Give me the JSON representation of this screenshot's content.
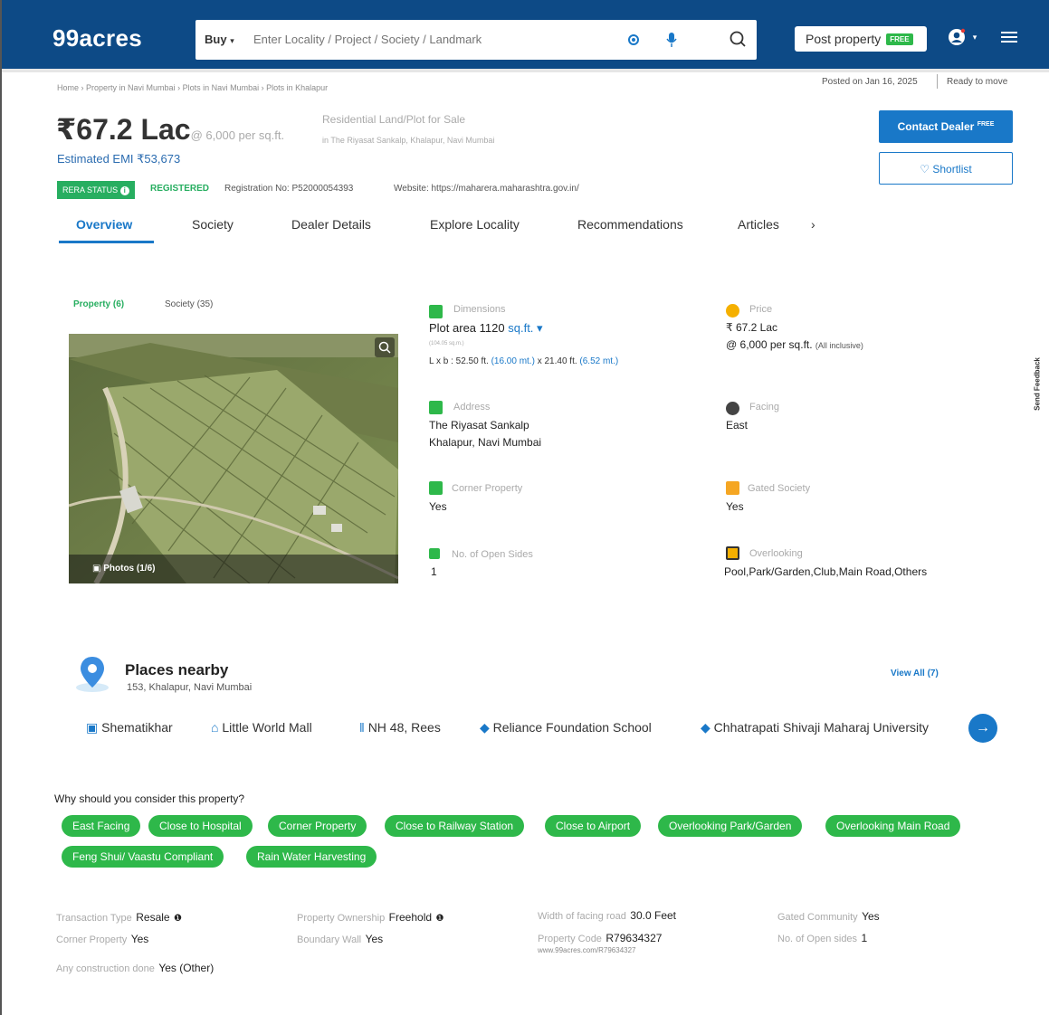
{
  "header": {
    "logo": "99acres",
    "search_mode": "Buy",
    "search_placeholder": "Enter Locality / Project / Society / Landmark",
    "post_label": "Post property",
    "post_badge": "FREE"
  },
  "breadcrumb": {
    "items": [
      "Home",
      "Property in Navi Mumbai",
      "Plots in Navi Mumbai",
      "Plots in Khalapur"
    ],
    "posted": "Posted on Jan 16, 2025",
    "ready": "Ready to move"
  },
  "summary": {
    "price": "₹67.2 Lac",
    "per_sqft": "@ 6,000 per sq.ft.",
    "emi": "Estimated EMI ₹53,673",
    "type": "Residential Land/Plot for Sale",
    "location": "in The Riyasat Sankalp, Khalapur, Navi Mumbai",
    "rera_status": "RERA STATUS",
    "registered": "REGISTERED",
    "registration": "Registration No: P52000054393",
    "website": "Website: https://maharera.maharashtra.gov.in/",
    "contact_label": "Contact Dealer",
    "contact_badge": "FREE",
    "shortlist_label": "Shortlist"
  },
  "tabs": [
    "Overview",
    "Society",
    "Dealer Details",
    "Explore Locality",
    "Recommendations",
    "Articles"
  ],
  "media": {
    "property_tab": "Property (6)",
    "society_tab": "Society (35)",
    "photos_label": "Photos (1/6)"
  },
  "details": {
    "dimensions": {
      "label": "Dimensions",
      "plot_area": "Plot area 1120",
      "unit": "sq.ft.",
      "sqm": "(104.05 sq.m.)",
      "lxb": "L x b : 52.50 ft.",
      "lxb_m1": "(16.00 mt.)",
      "x": "x 21.40 ft.",
      "lxb_m2": "(6.52 mt.)"
    },
    "price": {
      "label": "Price",
      "value": "₹ 67.2 Lac",
      "per": "@ 6,000 per sq.ft.",
      "incl": "(All inclusive)"
    },
    "address": {
      "label": "Address",
      "line1": "The Riyasat Sankalp",
      "line2": "Khalapur, Navi Mumbai"
    },
    "facing": {
      "label": "Facing",
      "value": "East"
    },
    "corner": {
      "label": "Corner Property",
      "value": "Yes"
    },
    "gated": {
      "label": "Gated Society",
      "value": "Yes"
    },
    "open_sides": {
      "label": "No. of Open Sides",
      "value": "1"
    },
    "overlooking": {
      "label": "Overlooking",
      "value": "Pool,Park/Garden,Club,Main Road,Others"
    }
  },
  "places": {
    "title": "Places nearby",
    "subtitle": "153, Khalapur, Navi Mumbai",
    "view_all": "View All (7)",
    "items": [
      "Shematikhar",
      "Little World Mall",
      "NH 48, Rees",
      "Reliance Foundation School",
      "Chhatrapati Shivaji Maharaj University"
    ]
  },
  "why": {
    "title": "Why should you consider this property?",
    "chips_row1": [
      "East Facing",
      "Close to Hospital",
      "Corner Property",
      "Close to Railway Station",
      "Close to Airport",
      "Overlooking Park/Garden",
      "Overlooking Main Road"
    ],
    "chips_row2": [
      "Feng Shui/ Vaastu Compliant",
      "Rain Water Harvesting"
    ]
  },
  "more": {
    "transaction": {
      "label": "Transaction Type",
      "value": "Resale"
    },
    "ownership": {
      "label": "Property Ownership",
      "value": "Freehold"
    },
    "width": {
      "label": "Width of facing road",
      "value": "30.0 Feet"
    },
    "gated_community": {
      "label": "Gated Community",
      "value": "Yes"
    },
    "corner": {
      "label": "Corner Property",
      "value": "Yes"
    },
    "boundary": {
      "label": "Boundary Wall",
      "value": "Yes"
    },
    "code": {
      "label": "Property Code",
      "value": "R79634327",
      "sub": "www.99acres.com/R79634327"
    },
    "open_sides": {
      "label": "No. of Open sides",
      "value": "1"
    },
    "construction": {
      "label": "Any construction done",
      "value": "Yes (Other)"
    }
  },
  "feedback": "Send Feedback",
  "colors": {
    "brand": "#0d4a86",
    "accent": "#1978c8",
    "green": "#2eb84a"
  }
}
